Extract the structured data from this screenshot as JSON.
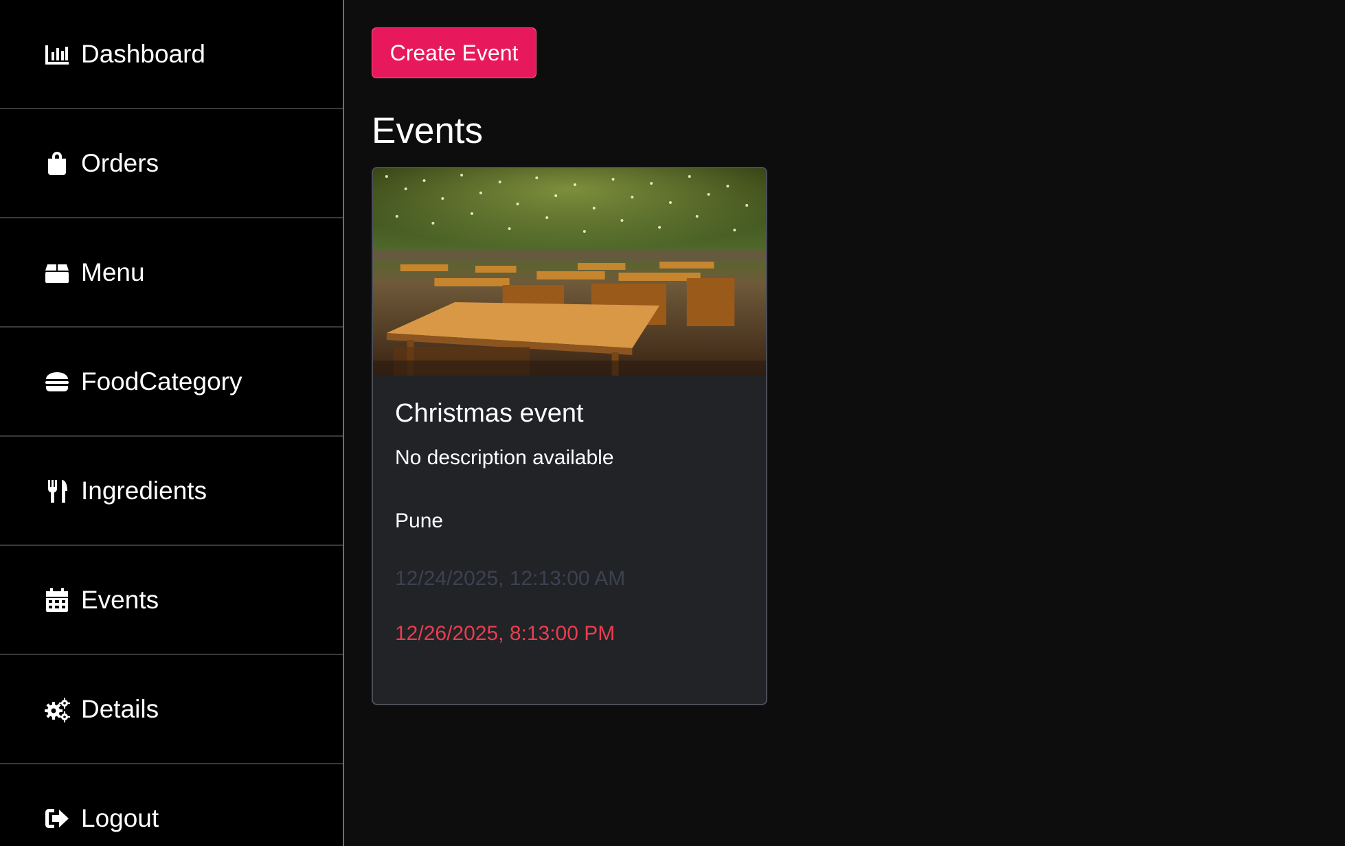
{
  "sidebar": {
    "items": [
      {
        "label": "Dashboard",
        "icon": "chart-bar-icon"
      },
      {
        "label": "Orders",
        "icon": "shopping-bag-icon"
      },
      {
        "label": "Menu",
        "icon": "box-icon"
      },
      {
        "label": "FoodCategory",
        "icon": "hamburger-icon"
      },
      {
        "label": "Ingredients",
        "icon": "utensils-icon"
      },
      {
        "label": "Events",
        "icon": "calendar-icon"
      },
      {
        "label": "Details",
        "icon": "gears-icon"
      },
      {
        "label": "Logout",
        "icon": "sign-out-icon"
      }
    ]
  },
  "main": {
    "create_button_label": "Create Event",
    "title": "Events",
    "events": [
      {
        "title": "Christmas event",
        "description": "No description available",
        "location": "Pune",
        "start": "12/24/2025, 12:13:00 AM",
        "end": "12/26/2025, 8:13:00 PM"
      }
    ]
  },
  "colors": {
    "accent": "#e8185d",
    "background": "#0d0d0d",
    "sidebar": "#000000",
    "card": "#212327",
    "end_date": "#ea3d4e",
    "start_date": "#3d4250"
  }
}
